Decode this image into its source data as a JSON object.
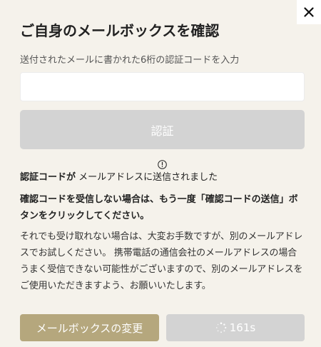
{
  "dialog": {
    "title": "ご自身のメールボックスを確認",
    "close_icon": "close-icon"
  },
  "code_field": {
    "label": "送付されたメールに書かれた6桁の認証コードを入力",
    "value": "",
    "placeholder": ""
  },
  "verify_button": {
    "label": "認証"
  },
  "notice": {
    "sent_bold": "認証コードが",
    "sent_rest": "メールアドレスに送信されました",
    "icon": "info-icon"
  },
  "instructions": {
    "bold_text": "確認コードを受信しない場合は、もう一度「確認コードの送信」ボタンをクリックしてください。",
    "body_text": "それでも受け取れない場合は、大変お手数ですが、別のメールアドレスでお試しください。 携帯電話の通信会社のメールアドレスの場合うまく受信できない可能性がございますので、別のメールアドレスをご使用いただきますよう、お願いいたします。"
  },
  "actions": {
    "change_mailbox_label": "メールボックスの変更",
    "resend_countdown": "161s",
    "resend_icon": "spinner-icon"
  },
  "colors": {
    "background": "#f5f2eb",
    "disabled_button": "#d3d3d3",
    "accent_button": "#b5a77d"
  }
}
